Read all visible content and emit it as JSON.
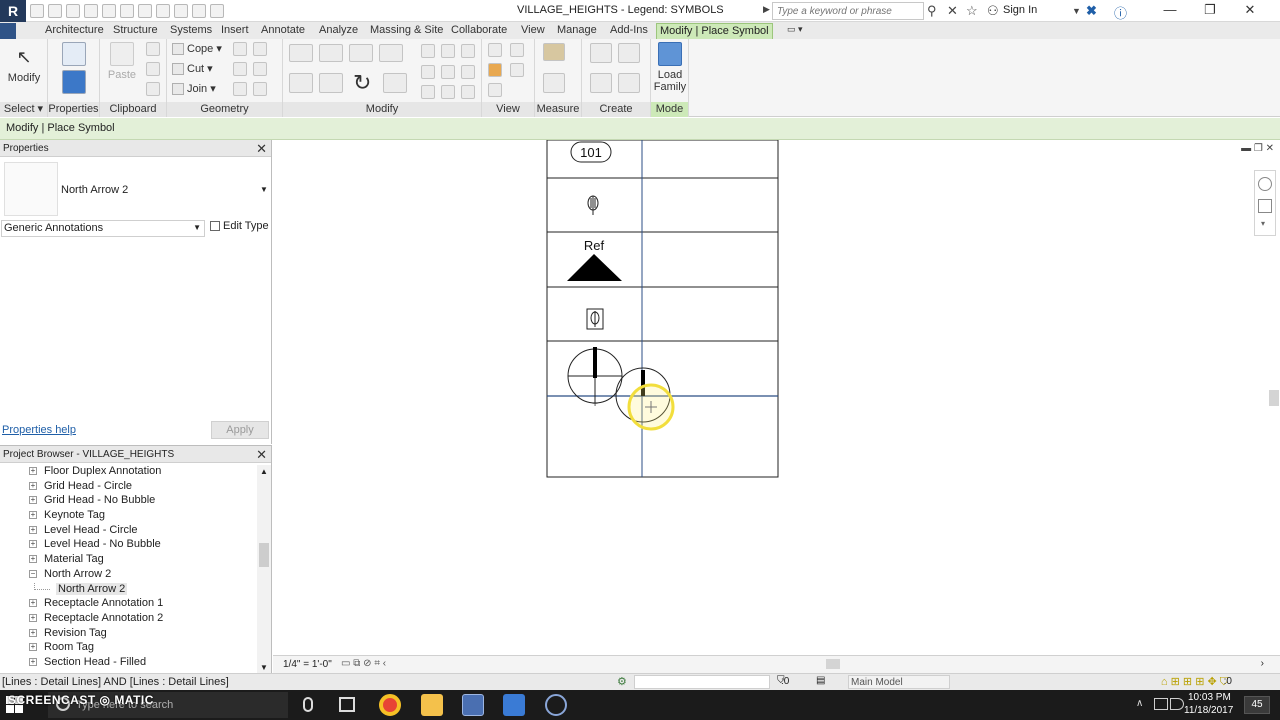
{
  "app": {
    "logo_letter": "R",
    "window_title": "VILLAGE_HEIGHTS - Legend: SYMBOLS",
    "search_placeholder": "Type a keyword or phrase",
    "sign_in": "Sign In",
    "accent": "#cde9b8"
  },
  "ribbon_tabs": [
    "Architecture",
    "Structure",
    "Systems",
    "Insert",
    "Annotate",
    "Analyze",
    "Massing & Site",
    "Collaborate",
    "View",
    "Manage",
    "Add-Ins",
    "Modify | Place Symbol"
  ],
  "ribbon": {
    "modify_label": "Modify",
    "paste_label": "Paste",
    "cope_label": "Cope",
    "cut_label": "Cut",
    "join_label": "Join",
    "load_family_line1": "Load",
    "load_family_line2": "Family",
    "groups": {
      "select": "Select",
      "properties": "Properties",
      "clipboard": "Clipboard",
      "geometry": "Geometry",
      "modify": "Modify",
      "view": "View",
      "measure": "Measure",
      "create": "Create",
      "mode": "Mode"
    }
  },
  "options_bar": {
    "text": "Modify | Place Symbol"
  },
  "properties": {
    "header": "Properties",
    "type_name": "North Arrow 2",
    "filter": "Generic Annotations",
    "edit_type": "Edit Type",
    "help_link": "Properties help",
    "apply": "Apply"
  },
  "browser": {
    "header": "Project Browser - VILLAGE_HEIGHTS",
    "items": [
      {
        "label": "Floor Duplex Annotation",
        "state": "+"
      },
      {
        "label": "Grid Head - Circle",
        "state": "+"
      },
      {
        "label": "Grid Head - No Bubble",
        "state": "+"
      },
      {
        "label": "Keynote Tag",
        "state": "+"
      },
      {
        "label": "Level Head - Circle",
        "state": "+"
      },
      {
        "label": "Level Head - No Bubble",
        "state": "+"
      },
      {
        "label": "Material Tag",
        "state": "+"
      },
      {
        "label": "North Arrow 2",
        "state": "−"
      },
      {
        "label": "North Arrow 2",
        "state": "child"
      },
      {
        "label": "Receptacle Annotation 1",
        "state": "+"
      },
      {
        "label": "Receptacle Annotation 2",
        "state": "+"
      },
      {
        "label": "Revision Tag",
        "state": "+"
      },
      {
        "label": "Room Tag",
        "state": "+"
      },
      {
        "label": "Section Head - Filled",
        "state": "+"
      }
    ]
  },
  "legend": {
    "tag_number": "101",
    "ref_label": "Ref"
  },
  "viewbar": {
    "scale": "1/4\" = 1'-0\""
  },
  "status": {
    "text": "[Lines : Detail Lines] AND [Lines : Detail Lines]",
    "selection_count": ":0",
    "model": "Main Model",
    "filter_count": ":0"
  },
  "taskbar": {
    "search_placeholder": "Type here to search",
    "recorder_brand": "SCREENCAST ◎ MATIC",
    "time": "10:03 PM",
    "date": "11/18/2017",
    "notifications": "45"
  }
}
